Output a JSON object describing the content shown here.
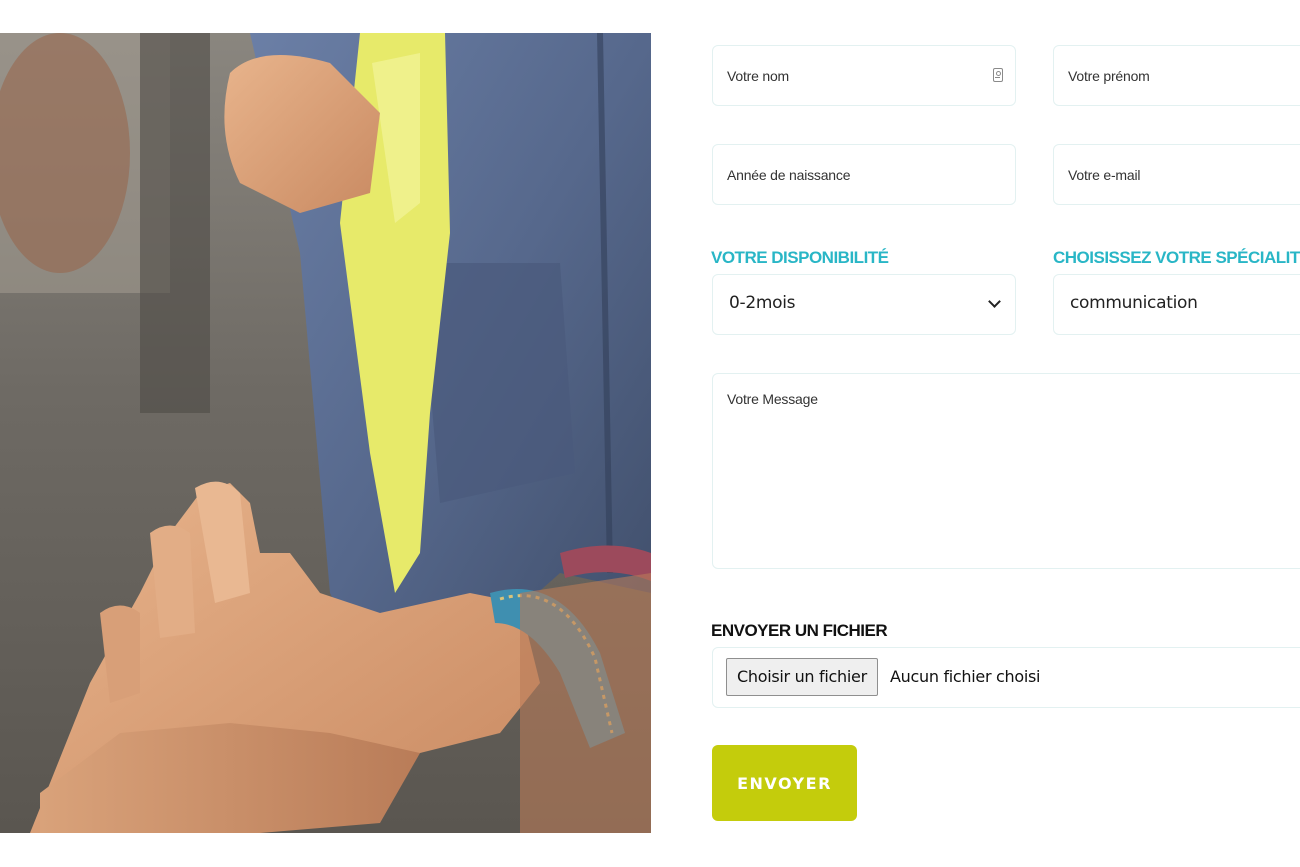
{
  "form": {
    "name_placeholder": "Votre nom",
    "firstname_placeholder": "Votre prénom",
    "birthyear_placeholder": "Année de naissance",
    "email_placeholder": "Votre e-mail",
    "availability_label": "VOTRE DISPONIBILITÉ",
    "availability_value": "0-2mois",
    "specialty_label": "CHOISISSEZ VOTRE SPÉCIALITÉ",
    "specialty_value": "communication",
    "message_placeholder": "Votre Message",
    "file_label": "ENVOYER UN FICHIER",
    "file_button": "Choisir un fichier",
    "file_status": "Aucun fichier choisi",
    "submit_label": "ENVOYER"
  },
  "colors": {
    "accent_teal": "#29b6c6",
    "submit_green": "#c4cc0c",
    "field_border": "#e3f1f1"
  },
  "icons": {
    "name_field_icon": "contact-card-icon",
    "select_icon": "chevron-down-icon"
  }
}
